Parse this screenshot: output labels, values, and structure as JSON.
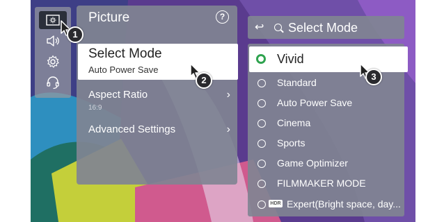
{
  "icon_bar": {
    "items": [
      {
        "name": "picture-icon",
        "selected": true
      },
      {
        "name": "speaker-icon",
        "selected": false
      },
      {
        "name": "gear-icon",
        "selected": false
      },
      {
        "name": "headset-icon",
        "selected": false
      }
    ]
  },
  "picture_menu": {
    "title": "Picture",
    "help_label": "?",
    "selected_item": {
      "label": "Select Mode",
      "value": "Auto Power Save"
    },
    "items": [
      {
        "label": "Aspect Ratio",
        "value": "16:9"
      },
      {
        "label": "Advanced Settings",
        "value": ""
      }
    ]
  },
  "select_mode_menu": {
    "back_symbol": "↩",
    "title": "Select Mode",
    "options": [
      {
        "label": "Vivid",
        "selected": true
      },
      {
        "label": "Standard",
        "selected": false
      },
      {
        "label": "Auto Power Save",
        "selected": false
      },
      {
        "label": "Cinema",
        "selected": false
      },
      {
        "label": "Sports",
        "selected": false
      },
      {
        "label": "Game Optimizer",
        "selected": false
      },
      {
        "label": "FILMMAKER MODE",
        "selected": false
      },
      {
        "label": "Expert(Bright space, day...",
        "selected": false,
        "badge": "HDR"
      }
    ]
  },
  "step_badges": [
    "1",
    "2",
    "3"
  ],
  "colors": {
    "accent_green": "#2fa34f",
    "panel": "#808492",
    "badge": "#2a2a2e"
  }
}
